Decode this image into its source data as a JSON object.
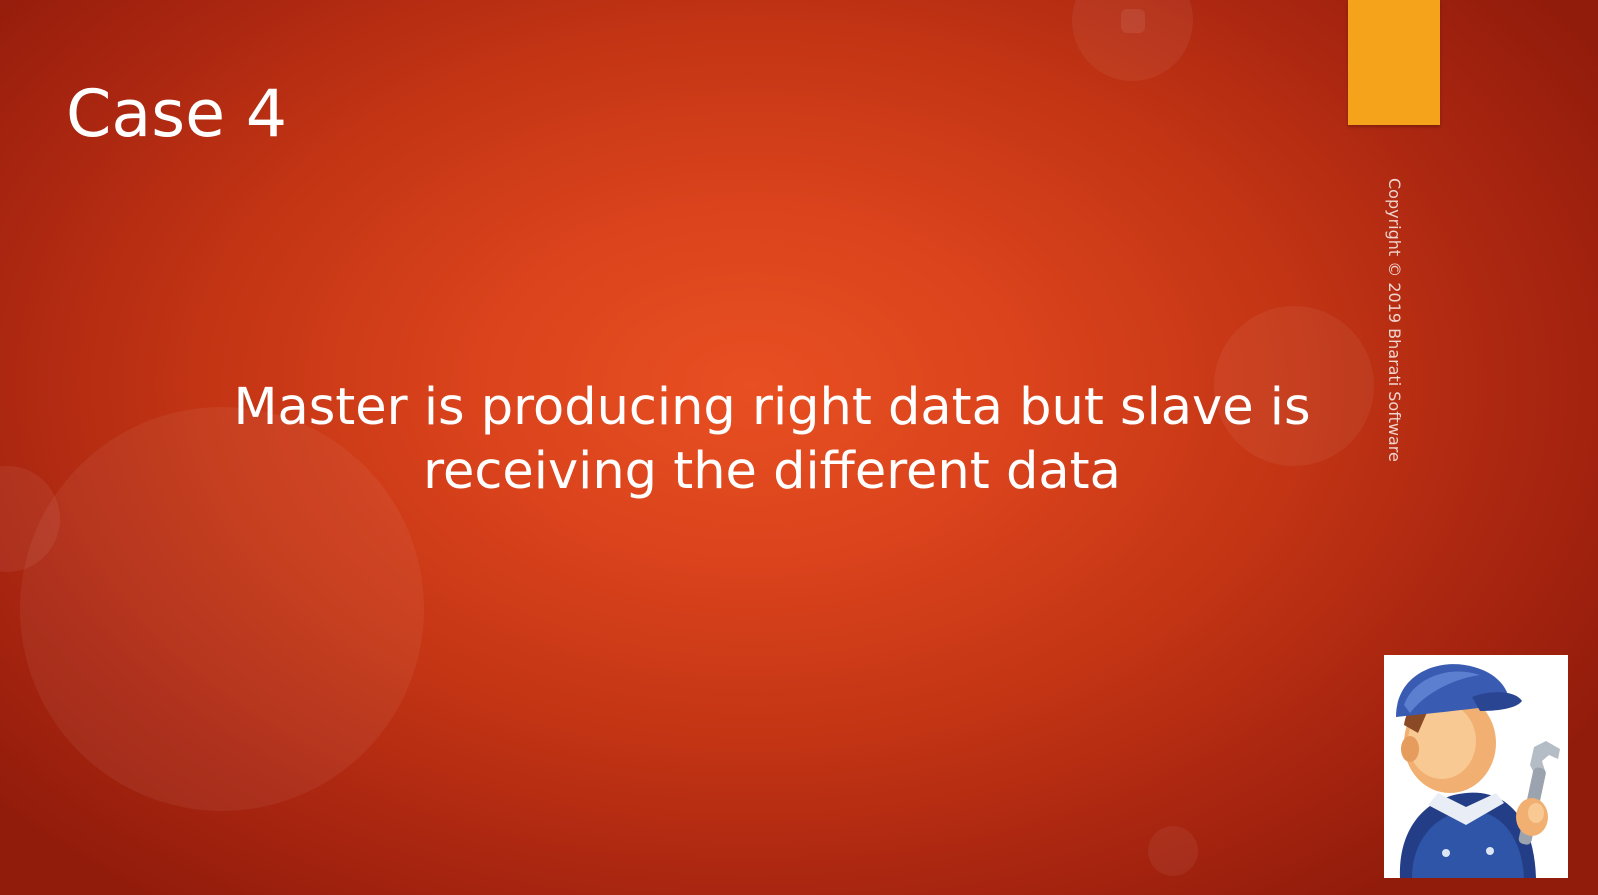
{
  "slide": {
    "title": "Case 4",
    "body": "Master is producing right data but slave is receiving the different data",
    "copyright": "Copyright © 2019 Bharati Software"
  },
  "theme": {
    "background_center": "#e84f22",
    "background_edge": "#921c0b",
    "accent": "#f5a31a",
    "text": "#ffffff"
  },
  "icons": {
    "mascot": "mechanic-with-wrench-icon"
  }
}
